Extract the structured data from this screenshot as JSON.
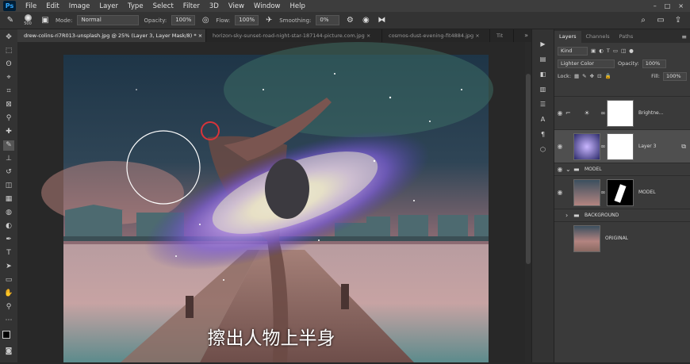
{
  "menu": {
    "items": [
      "File",
      "Edit",
      "Image",
      "Layer",
      "Type",
      "Select",
      "Filter",
      "3D",
      "View",
      "Window",
      "Help"
    ]
  },
  "options": {
    "brush_size": "500",
    "mode_label": "Mode:",
    "mode_value": "Normal",
    "opacity_label": "Opacity:",
    "opacity_value": "100%",
    "flow_label": "Flow:",
    "flow_value": "100%",
    "smoothing_label": "Smoothing:",
    "smoothing_value": "0%"
  },
  "tabs": [
    {
      "label": "drew-colins-ri7R013-unsplash.jpg @ 25% (Layer 3, Layer Mask/8) *",
      "close": "×"
    },
    {
      "label": "horizon-sky-sunset-road-night-star-187144-picture.com.jpg",
      "close": "×"
    },
    {
      "label": "cosmos-dust-evening-fit4884.jpg",
      "close": "×"
    },
    {
      "label": "Tit",
      "close": ""
    }
  ],
  "subtitle": "擦出人物上半身",
  "panel": {
    "tabs": [
      "Layers",
      "Channels",
      "Paths"
    ],
    "filter_kind": "Kind",
    "blend_mode": "Lighter Color",
    "opacity_label": "Opacity:",
    "opacity_value": "100%",
    "lock_label": "Lock:",
    "fill_label": "Fill:",
    "fill_value": "100%",
    "layers": [
      {
        "name": "Brightne..."
      },
      {
        "name": "Layer 3"
      },
      {
        "name": "MODEL"
      },
      {
        "name": "MODEL"
      },
      {
        "name": "BACKGROUND"
      },
      {
        "name": "ORIGINAL"
      }
    ]
  },
  "colors": {
    "accent": "#31a8ff",
    "brush_cursor": "#d8343a"
  }
}
